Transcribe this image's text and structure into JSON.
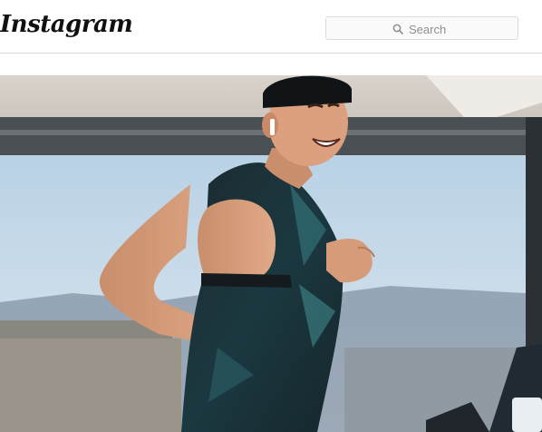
{
  "header": {
    "logo": "Instagram",
    "search_placeholder": "Search"
  },
  "post": {
    "image_alt": "photo"
  },
  "icons": {
    "search": "search-icon"
  }
}
